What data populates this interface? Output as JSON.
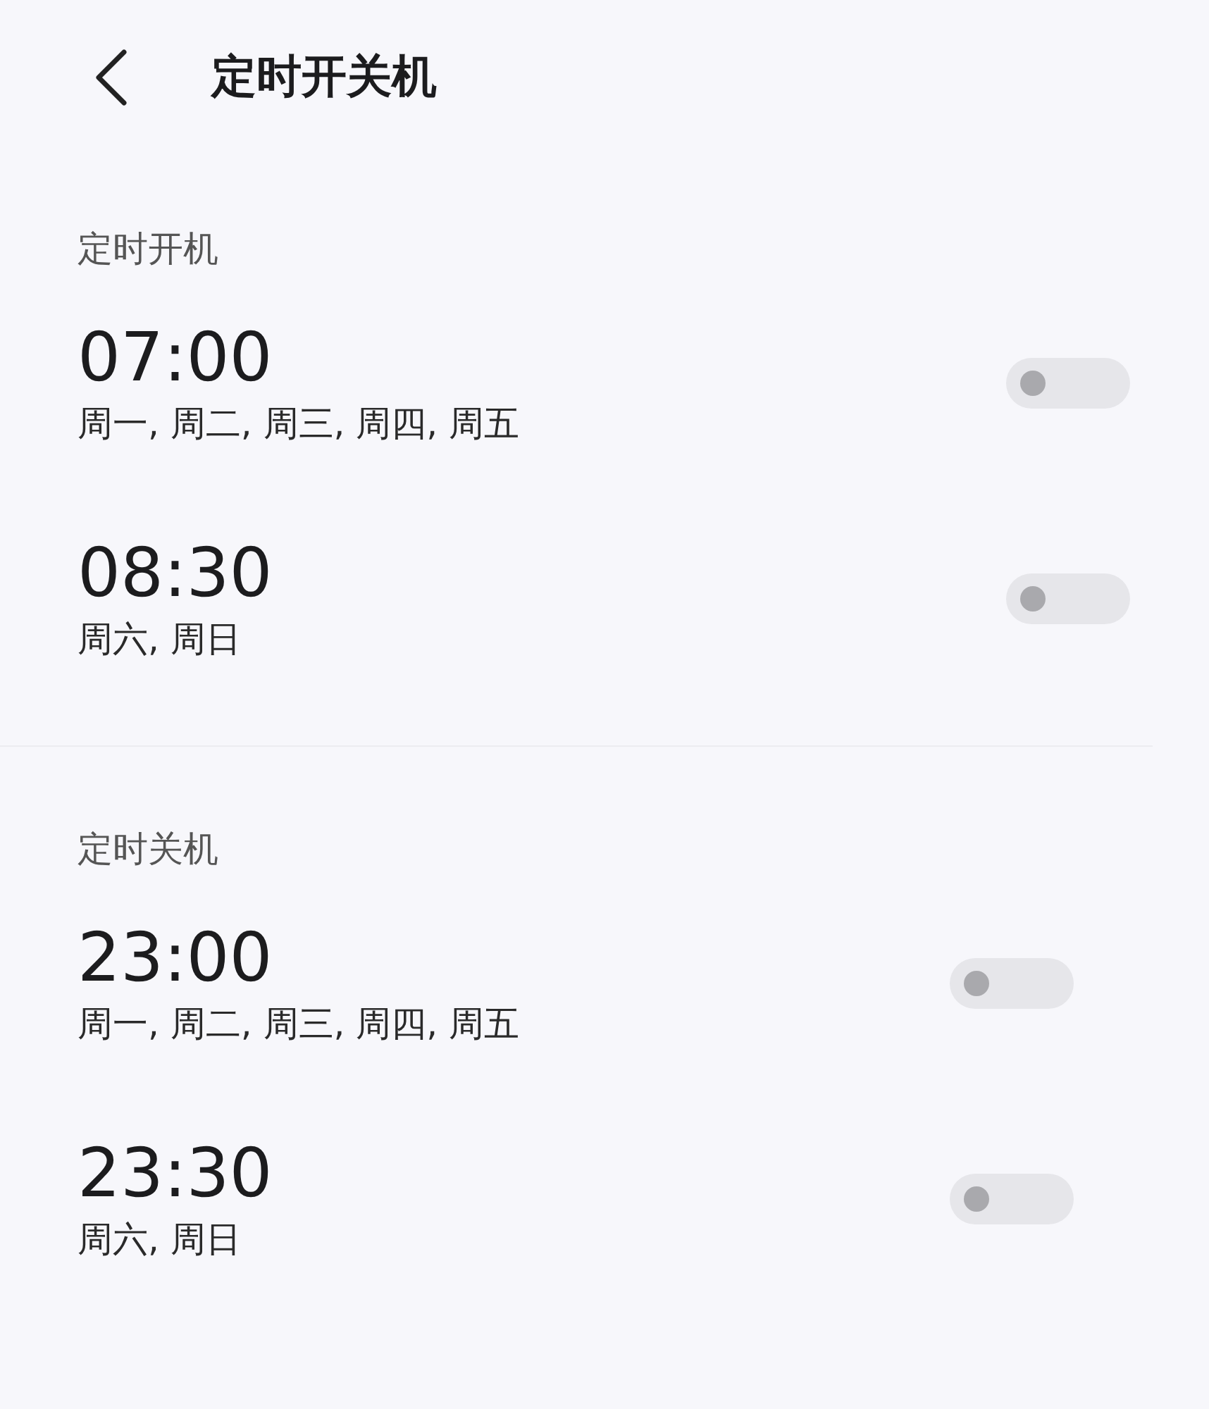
{
  "header": {
    "title": "定时开关机"
  },
  "sections": [
    {
      "label": "定时开机",
      "items": [
        {
          "time": "07:00",
          "days": "周一, 周二, 周三, 周四, 周五",
          "on": false
        },
        {
          "time": "08:30",
          "days": "周六, 周日",
          "on": false
        }
      ]
    },
    {
      "label": "定时关机",
      "items": [
        {
          "time": "23:00",
          "days": "周一, 周二, 周三, 周四, 周五",
          "on": false
        },
        {
          "time": "23:30",
          "days": "周六, 周日",
          "on": false
        }
      ]
    }
  ]
}
